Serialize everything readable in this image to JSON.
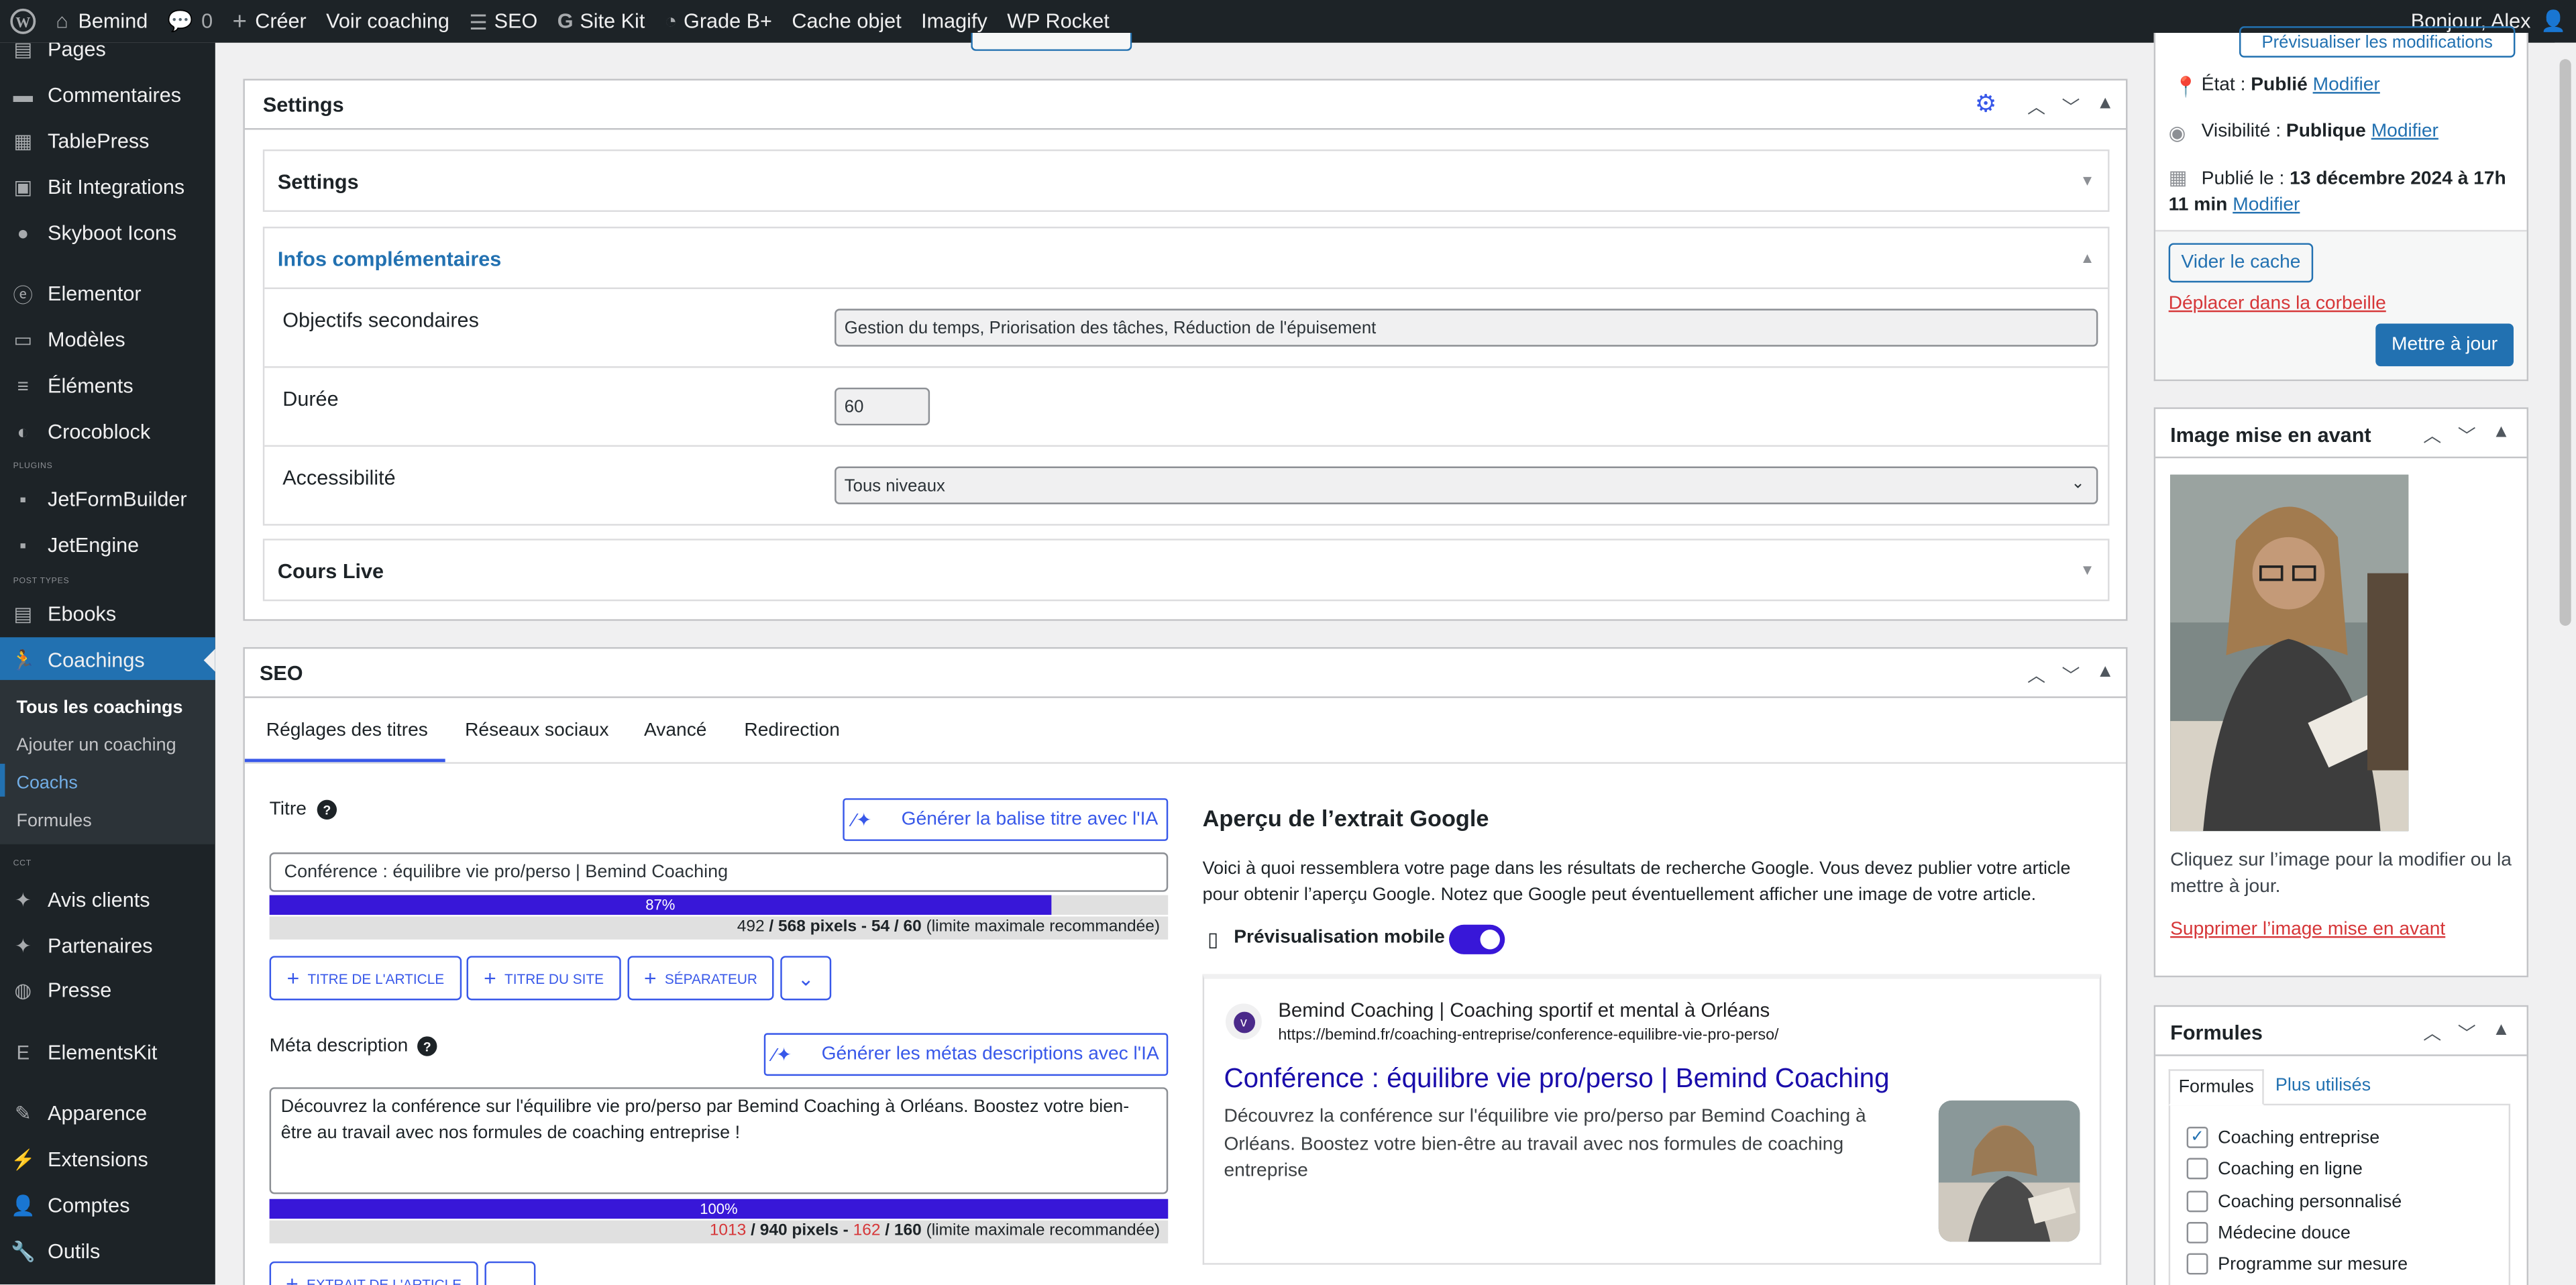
{
  "adminbar": {
    "items": [
      "Bemind",
      "0",
      "Créer",
      "Voir coaching",
      "SEO",
      "Site Kit",
      "Grade B+",
      "Cache objet",
      "Imagify",
      "WP Rocket"
    ],
    "greeting": "Bonjour, Alex"
  },
  "sidebar": {
    "items": [
      "Pages",
      "Commentaires",
      "TablePress",
      "Bit Integrations",
      "Skyboot Icons",
      "Elementor",
      "Modèles",
      "Éléments",
      "Crocoblock",
      "JetFormBuilder",
      "JetEngine",
      "Ebooks",
      "Coachings",
      "Avis clients",
      "Partenaires",
      "Presse",
      "ElementsKit",
      "Apparence",
      "Extensions",
      "Comptes",
      "Outils"
    ],
    "sep_plugins": "PLUGINS",
    "sep_post_types": "POST TYPES",
    "sep_cct": "CCT",
    "submenu": [
      "Tous les coachings",
      "Ajouter un coaching",
      "Coachs",
      "Formules"
    ]
  },
  "settings_box": {
    "title": "Settings",
    "sub_settings": "Settings",
    "infos_title": "Infos complémentaires",
    "objectifs_label": "Objectifs secondaires",
    "objectifs_value": "Gestion du temps, Priorisation des tâches, Réduction de l'épuisement",
    "duree_label": "Durée",
    "duree_value": "60",
    "access_label": "Accessibilité",
    "access_value": "Tous niveaux",
    "cours_live": "Cours Live"
  },
  "seo_box": {
    "title": "SEO",
    "tabs": [
      "Réglages des titres",
      "Réseaux sociaux",
      "Avancé",
      "Redirection"
    ],
    "titre_label": "Titre",
    "gen_title_btn": "Générer la balise titre avec l'IA",
    "title_value": "Conférence : équilibre vie pro/perso | Bemind Coaching",
    "title_progress": 87,
    "title_progress_label": "87%",
    "title_count_a": "492",
    "title_count_b": " / 568 pixels - 54 ",
    "title_count_c": " / 60",
    "limit_text": " (limite maximale recommandée)",
    "chip_article": "TITRE DE L'ARTICLE",
    "chip_site": "TITRE DU SITE",
    "chip_sep": "SÉPARATEUR",
    "meta_label": "Méta description",
    "gen_meta_btn": "Générer les métas descriptions avec l'IA",
    "meta_value": "Découvrez la conférence sur l'équilibre vie pro/perso par Bemind Coaching à Orléans. Boostez votre bien-être au travail avec nos formules de coaching entreprise !",
    "meta_progress": 100,
    "meta_progress_label": "100%",
    "meta_count_a": "1013",
    "meta_count_b": " / 940 pixels - ",
    "meta_count_c": "162",
    "meta_count_d": " / 160",
    "chip_extrait": "EXTRAIT DE L'ARTICLE",
    "preview_title": "Aperçu de l’extrait Google",
    "preview_desc": "Voici à quoi ressemblera votre page dans les résultats de recherche Google. Vous devez publier votre article pour obtenir l’aperçu Google. Notez que Google peut éventuellement afficher une image de votre article.",
    "mobile_label": "Prévisualisation mobile",
    "mobile_on": true,
    "serp_site": "Bemind Coaching | Coaching sportif et mental à Orléans",
    "serp_url": "https://bemind.fr/coaching-entreprise/conference-equilibre-vie-pro-perso/",
    "serp_title": "Conférence : équilibre vie pro/perso | Bemind Coaching",
    "serp_desc": "Découvrez la conférence sur l'équilibre vie pro/perso par Bemind Coaching à Orléans. Boostez votre bien-être au travail avec nos formules de coaching entreprise"
  },
  "publish_box": {
    "preview_btn": "Prévisualiser les modifications",
    "etat_label": "État : ",
    "etat_value": "Publié",
    "visib_label": "Visibilité : ",
    "visib_value": "Publique",
    "pub_label": "Publié le : ",
    "pub_value_1": "13 décembre 2024 à 17h",
    "pub_value_2": "11 min",
    "modifier": "Modifier",
    "cache_btn": "Vider le cache",
    "trash_link": "Déplacer dans la corbeille",
    "update_btn": "Mettre à jour"
  },
  "image_box": {
    "title": "Image mise en avant",
    "hint": "Cliquez sur l’image pour la modifier ou la mettre à jour.",
    "remove_link": "Supprimer l’image mise en avant"
  },
  "formules_box": {
    "title": "Formules",
    "tabs": [
      "Formules",
      "Plus utilisés"
    ],
    "items": [
      {
        "label": "Coaching entreprise",
        "checked": true
      },
      {
        "label": "Coaching en ligne",
        "checked": false
      },
      {
        "label": "Coaching personnalisé",
        "checked": false
      },
      {
        "label": "Médecine douce",
        "checked": false
      },
      {
        "label": "Programme sur mesure",
        "checked": false
      }
    ]
  },
  "colors": {
    "accent": "#2271b1",
    "seo_purple": "#3817d8",
    "admin_dark": "#1d2327",
    "danger": "#d63638"
  }
}
